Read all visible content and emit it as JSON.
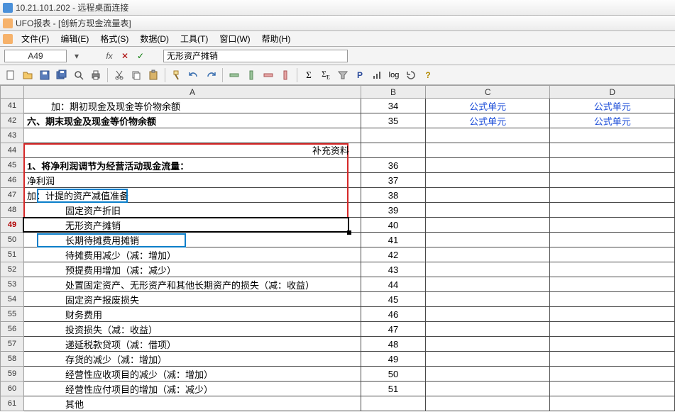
{
  "window": {
    "remote_title": "10.21.101.202 - 远程桌面连接",
    "app_title": "UFO报表 - [创新方现金流量表]"
  },
  "menus": {
    "file": "文件(F)",
    "edit": "编辑(E)",
    "format": "格式(S)",
    "data": "数据(D)",
    "tools": "工具(T)",
    "window": "窗口(W)",
    "help": "帮助(H)"
  },
  "namebox": {
    "cell_ref": "A49"
  },
  "formula_bar": {
    "value": "无形资产摊销"
  },
  "columns": [
    "",
    "A",
    "B",
    "C",
    "D"
  ],
  "rows": [
    {
      "n": "41",
      "a": "加：期初现金及现金等价物余额",
      "a_cls": "indent1",
      "b": "34",
      "c": "公式单元",
      "d": "公式单元"
    },
    {
      "n": "42",
      "a": "六、期末现金及现金等价物余额",
      "a_cls": "bold",
      "b": "35",
      "c": "公式单元",
      "d": "公式单元"
    },
    {
      "n": "43",
      "a": "",
      "b": "",
      "c": "",
      "d": ""
    },
    {
      "n": "44",
      "a": "",
      "a_note": "补充资料",
      "b": "",
      "c": "",
      "d": ""
    },
    {
      "n": "45",
      "a": "1、将净利润调节为经营活动现金流量：",
      "a_cls": "bold",
      "b": "36",
      "c": "",
      "d": ""
    },
    {
      "n": "46",
      "a": "净利润",
      "b": "37",
      "c": "",
      "d": ""
    },
    {
      "n": "47",
      "a": "加：计提的资产减值准备",
      "b": "38",
      "c": "",
      "d": ""
    },
    {
      "n": "48",
      "a": "固定资产折旧",
      "a_cls": "indent2",
      "b": "39",
      "c": "",
      "d": ""
    },
    {
      "n": "49",
      "a": "无形资产摊销",
      "a_cls": "indent2",
      "b": "40",
      "c": "",
      "d": "",
      "sel": true
    },
    {
      "n": "50",
      "a": "长期待摊费用摊销",
      "a_cls": "indent2",
      "b": "41",
      "c": "",
      "d": ""
    },
    {
      "n": "51",
      "a": "待摊费用减少（减：增加）",
      "a_cls": "indent2",
      "b": "42",
      "c": "",
      "d": ""
    },
    {
      "n": "52",
      "a": "预提费用增加（减：减少）",
      "a_cls": "indent2",
      "b": "43",
      "c": "",
      "d": ""
    },
    {
      "n": "53",
      "a": "处置固定资产、无形资产和其他长期资产的损失（减：收益）",
      "a_cls": "indent2",
      "b": "44",
      "c": "",
      "d": ""
    },
    {
      "n": "54",
      "a": "固定资产报废损失",
      "a_cls": "indent2",
      "b": "45",
      "c": "",
      "d": ""
    },
    {
      "n": "55",
      "a": "财务费用",
      "a_cls": "indent2",
      "b": "46",
      "c": "",
      "d": ""
    },
    {
      "n": "56",
      "a": "投资损失（减：收益）",
      "a_cls": "indent2",
      "b": "47",
      "c": "",
      "d": ""
    },
    {
      "n": "57",
      "a": "递延税款贷项（减：借项）",
      "a_cls": "indent2",
      "b": "48",
      "c": "",
      "d": ""
    },
    {
      "n": "58",
      "a": "存货的减少（减：增加）",
      "a_cls": "indent2",
      "b": "49",
      "c": "",
      "d": ""
    },
    {
      "n": "59",
      "a": "经营性应收项目的减少（减：增加）",
      "a_cls": "indent2",
      "b": "50",
      "c": "",
      "d": ""
    },
    {
      "n": "60",
      "a": "经营性应付项目的增加（减：减少）",
      "a_cls": "indent2",
      "b": "51",
      "c": "",
      "d": ""
    },
    {
      "n": "61",
      "a": "其他",
      "a_cls": "indent2",
      "b": "",
      "c": "",
      "d": ""
    }
  ]
}
